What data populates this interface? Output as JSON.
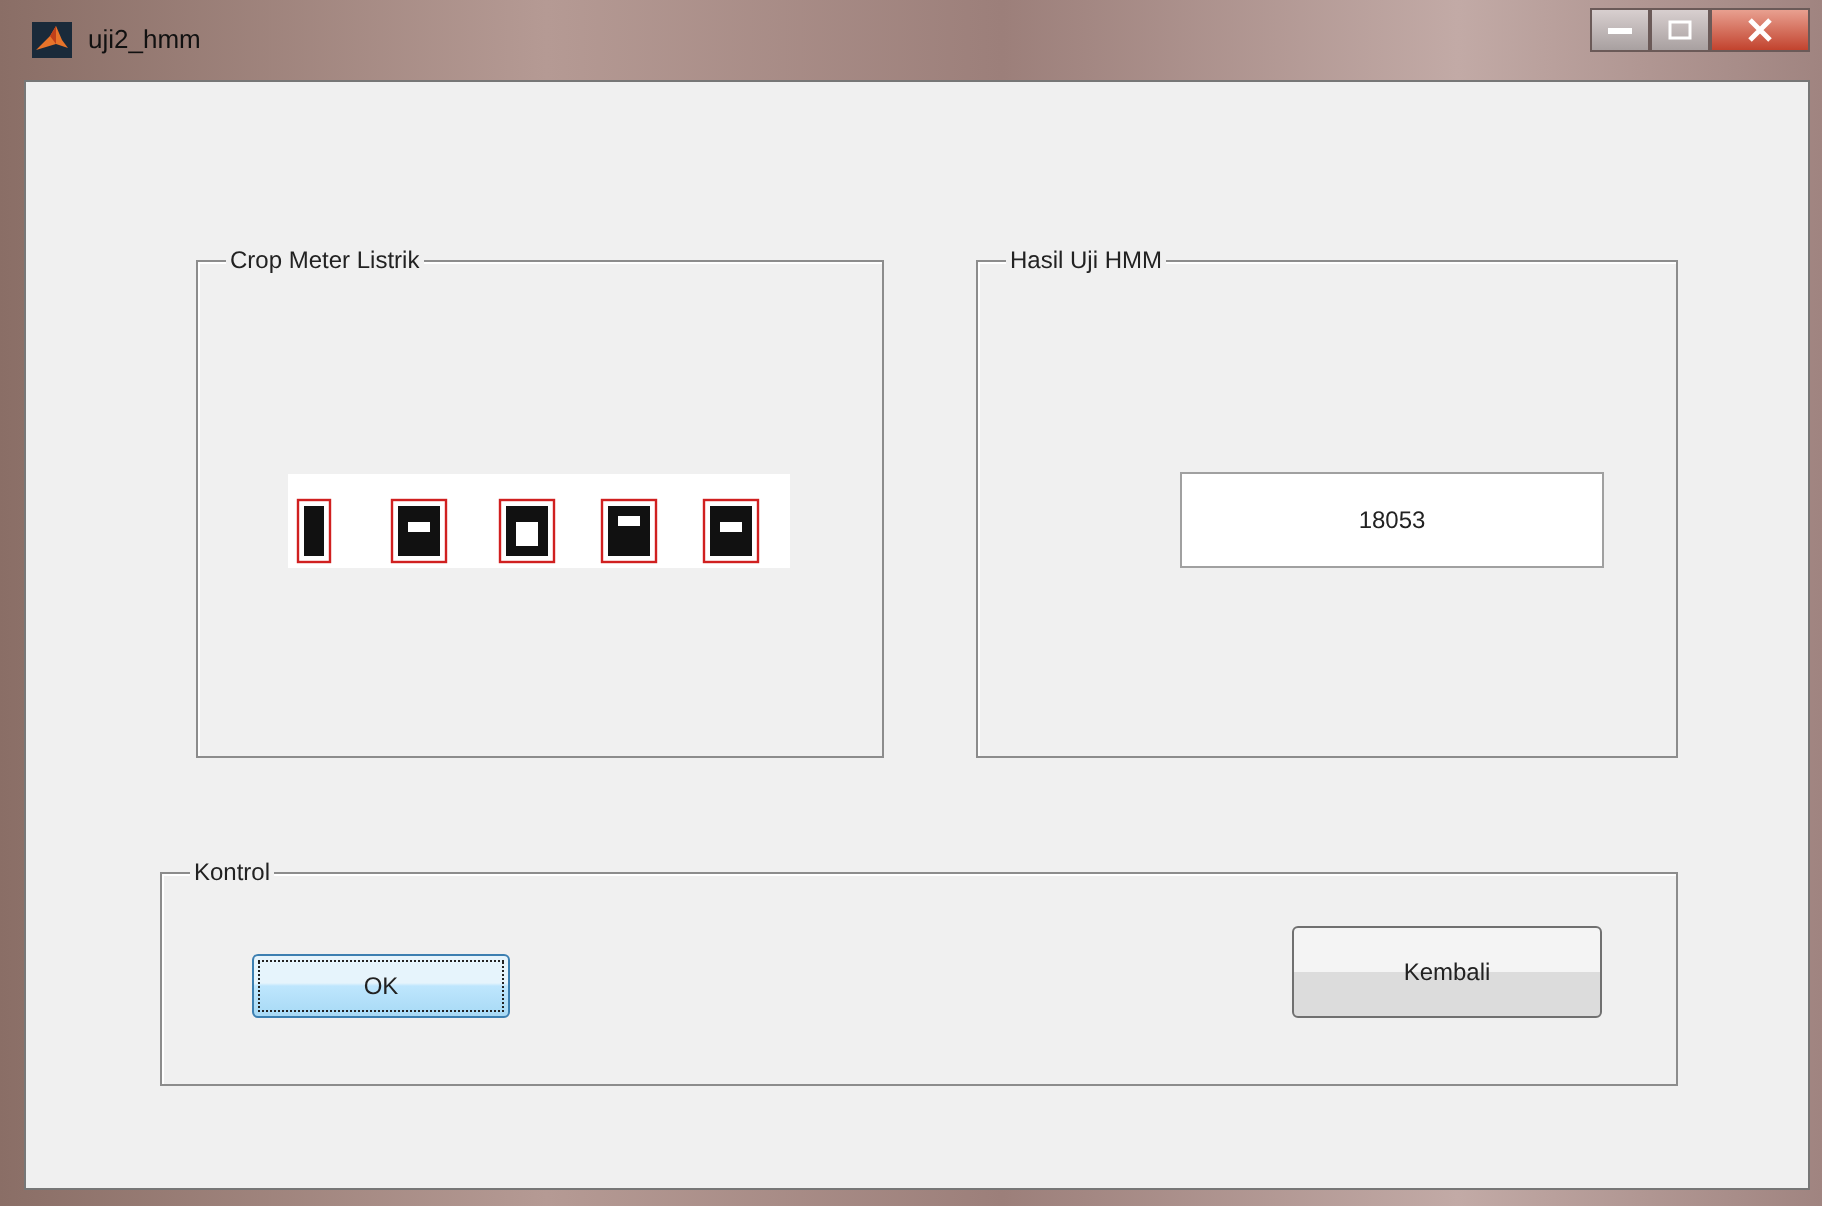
{
  "window": {
    "title": "uji2_hmm"
  },
  "crop_panel": {
    "title": "Crop Meter Listrik"
  },
  "result_panel": {
    "title": "Hasil Uji HMM",
    "value": "18053"
  },
  "control_panel": {
    "title": "Kontrol",
    "buttons": [
      {
        "label": "OK",
        "focused": true
      },
      {
        "label": "Kembali",
        "focused": false
      }
    ]
  }
}
